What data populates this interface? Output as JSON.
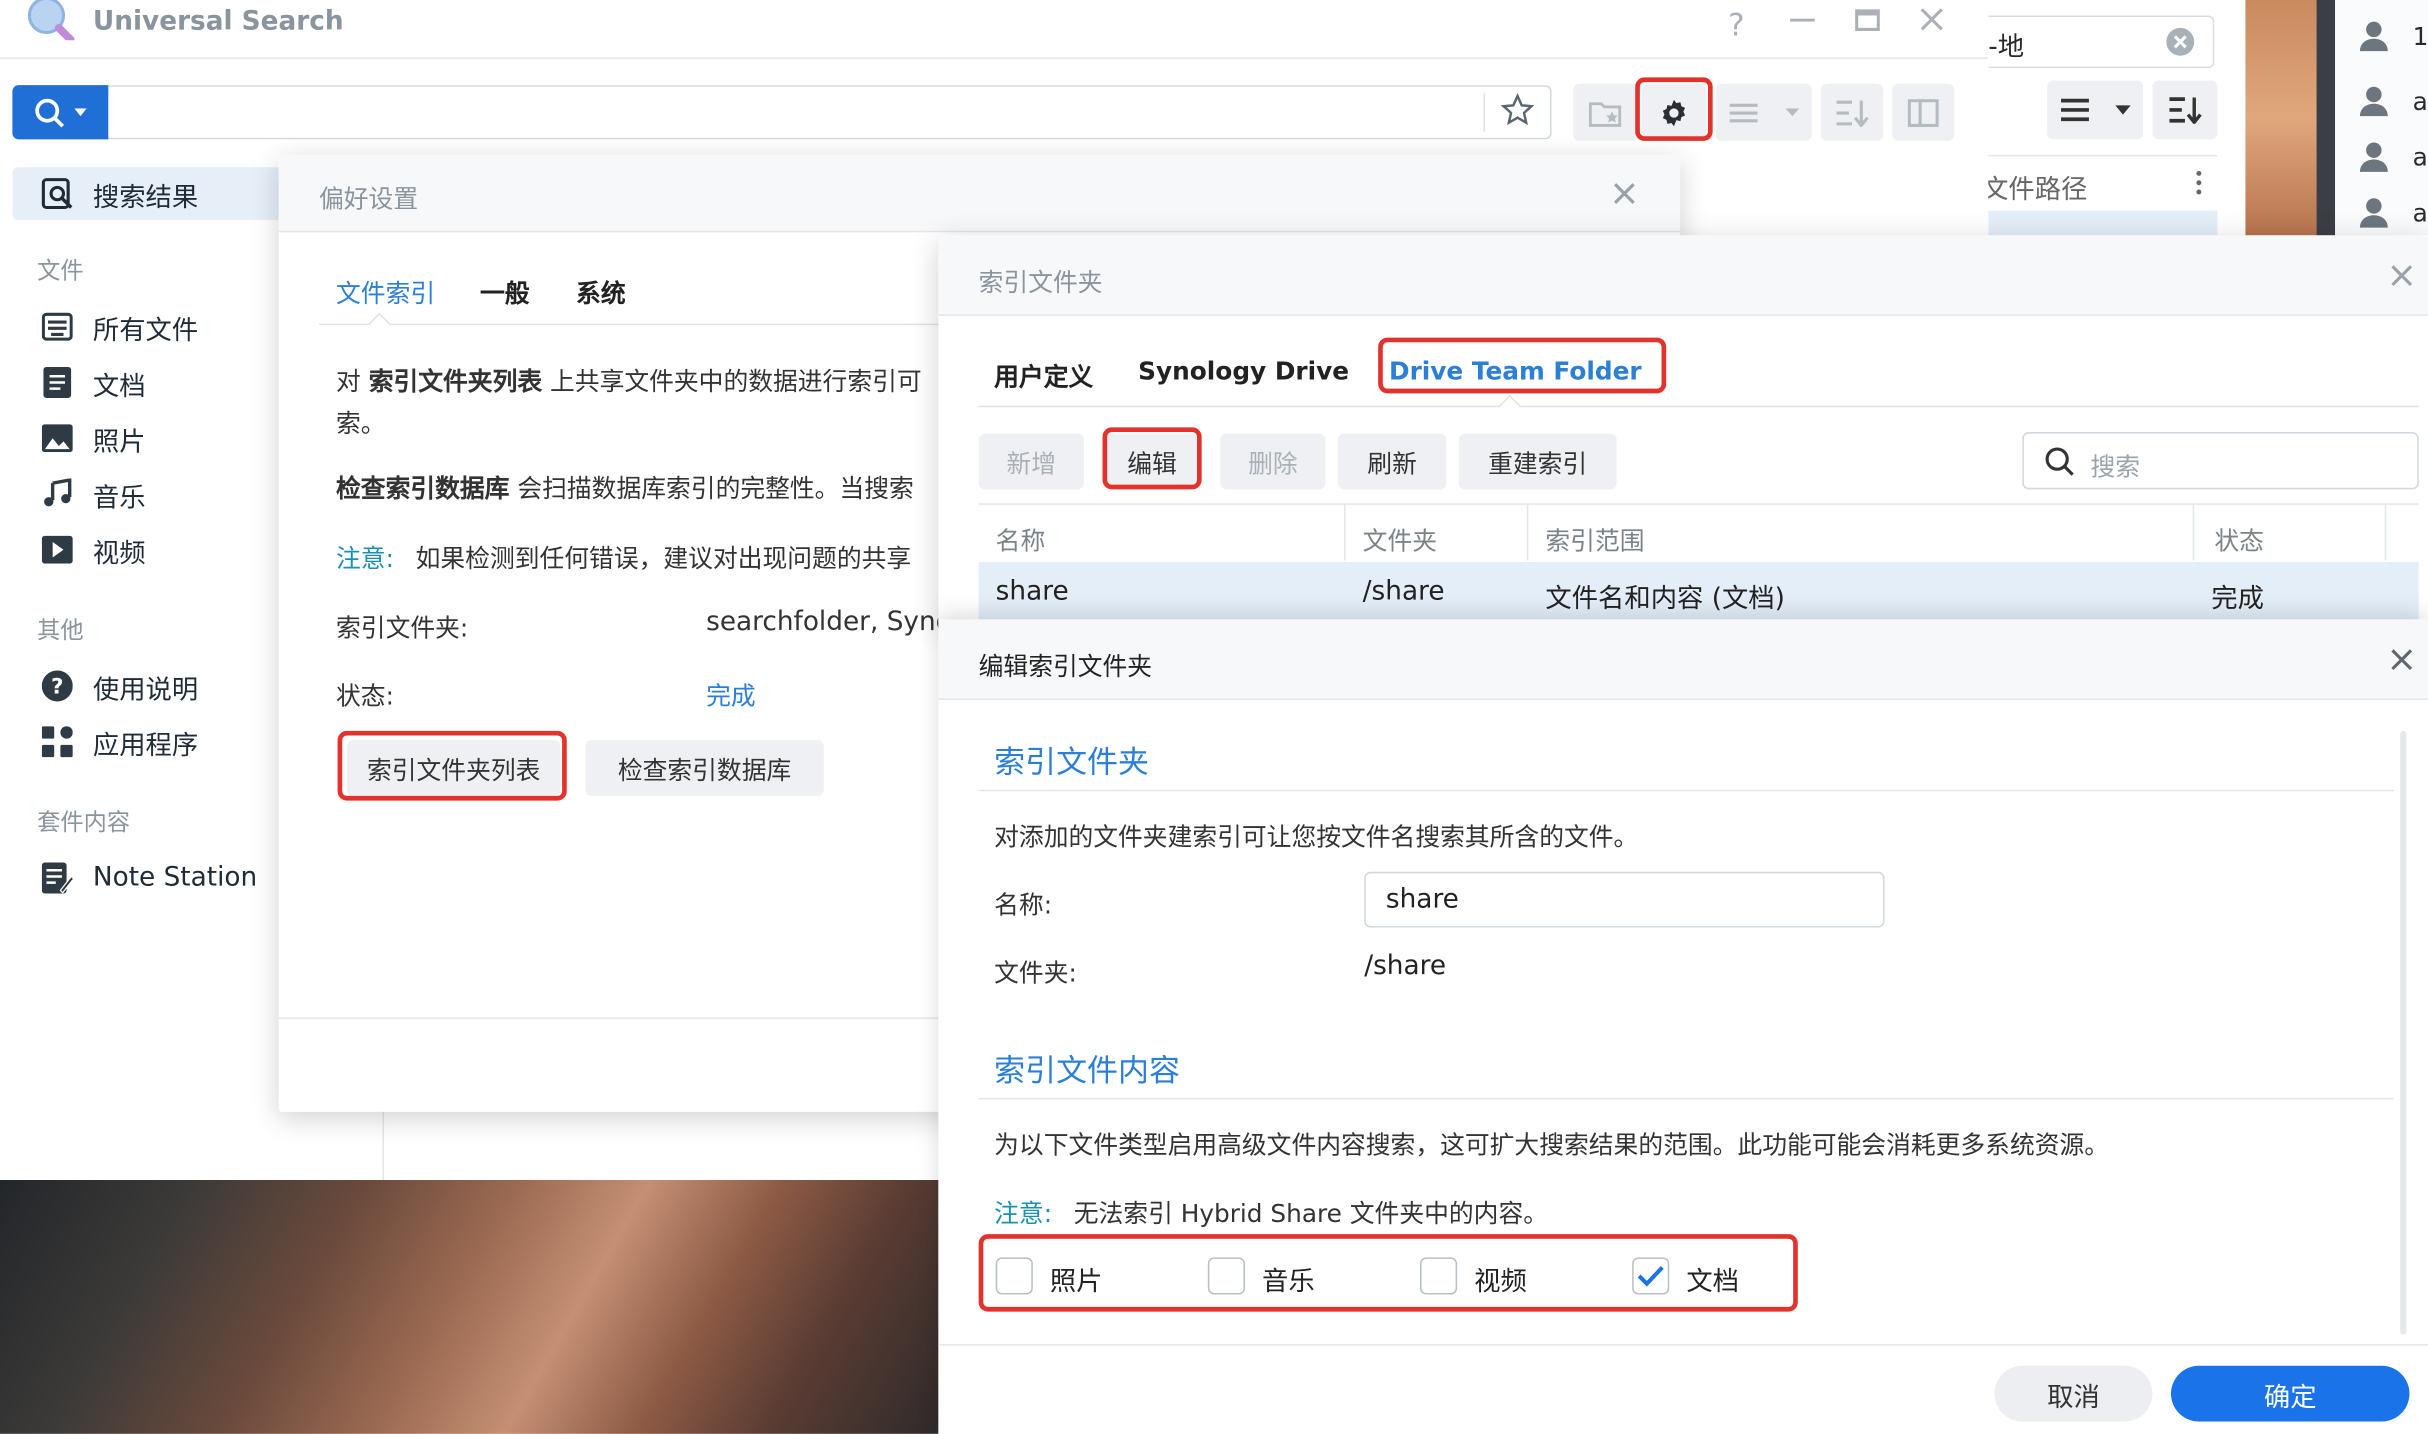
{
  "app": {
    "title": "Universal Search"
  },
  "search": {
    "placeholder": ""
  },
  "right_panel": {
    "location_text": "-地",
    "path_col": "文件路径",
    "users": [
      "1",
      "a",
      "a",
      "a"
    ]
  },
  "sidebar": {
    "results": "搜索结果",
    "files_header": "文件",
    "files": [
      "所有文件",
      "文档",
      "照片",
      "音乐",
      "视频"
    ],
    "other_header": "其他",
    "other": [
      "使用说明",
      "应用程序"
    ],
    "suite_header": "套件内容",
    "suite": [
      "Note Station"
    ]
  },
  "prefs": {
    "title": "偏好设置",
    "tabs": [
      "文件索引",
      "一般",
      "系统"
    ],
    "p1_a": "对 ",
    "p1_b": "索引文件夹列表",
    "p1_c": " 上共享文件夹中的数据进行索引可",
    "p1_d": "索。",
    "p2_a": "检查索引数据库",
    "p2_b": " 会扫描数据库索引的完整性。当搜索",
    "note_label": "注意:",
    "note_text": "如果检测到任何错误，建议对出现问题的共享",
    "folders_label": "索引文件夹:",
    "folders_value": "searchfolder, Sync",
    "status_label": "状态:",
    "status_value": "完成",
    "btn_list": "索引文件夹列表",
    "btn_check": "检查索引数据库"
  },
  "index_folder": {
    "title": "索引文件夹",
    "tabs": [
      "用户定义",
      "Synology Drive",
      "Drive Team Folder"
    ],
    "btn_add": "新增",
    "btn_edit": "编辑",
    "btn_delete": "删除",
    "btn_refresh": "刷新",
    "btn_rebuild": "重建索引",
    "search_placeholder": "搜索",
    "columns": [
      "名称",
      "文件夹",
      "索引范围",
      "状态"
    ],
    "row": {
      "name": "share",
      "folder": "/share",
      "scope": "文件名和内容 (文档)",
      "status": "完成"
    }
  },
  "edit": {
    "title": "编辑索引文件夹",
    "sec1": "索引文件夹",
    "desc1": "对添加的文件夹建索引可让您按文件名搜索其所含的文件。",
    "name_label": "名称:",
    "name_value": "share",
    "folder_label": "文件夹:",
    "folder_value": "/share",
    "sec2": "索引文件内容",
    "desc2": "为以下文件类型启用高级文件内容搜索，这可扩大搜索结果的范围。此功能可能会消耗更多系统资源。",
    "note_label": "注意:",
    "note_text": "无法索引 Hybrid Share 文件夹中的内容。",
    "types": [
      {
        "label": "照片",
        "checked": false
      },
      {
        "label": "音乐",
        "checked": false
      },
      {
        "label": "视频",
        "checked": false
      },
      {
        "label": "文档",
        "checked": true
      }
    ],
    "cancel": "取消",
    "ok": "确定"
  },
  "colors": {
    "accent": "#1a73e8",
    "highlight": "#e2322b",
    "link": "#2b7fd6"
  }
}
